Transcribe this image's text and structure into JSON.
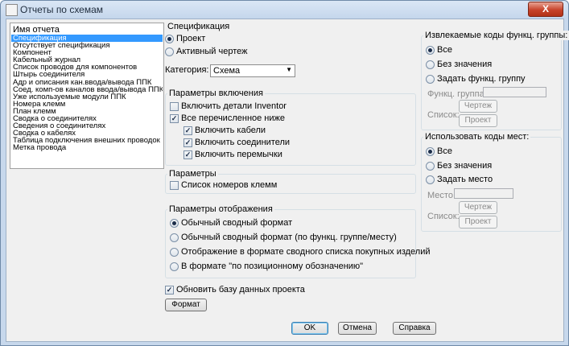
{
  "window": {
    "title": "Отчеты по схемам",
    "close": "X"
  },
  "report_list": {
    "header": "Имя отчета",
    "items": [
      "Спецификация",
      "Отсутствует спецификация",
      "Компонент",
      "Кабельный журнал",
      "Список проводов для компонентов",
      "Штырь соединителя",
      "Адр и описания кан.ввода/вывода ППК",
      "Соед. комп-ов каналов ввода/вывода ППК",
      "Уже используемые модули ППК",
      "Номера клемм",
      "План клемм",
      "Сводка о соединителях",
      "Сведения о соединителях",
      "Сводка о кабелях",
      "Таблица подключения внешних проводок",
      "Метка провода"
    ],
    "selected_index": 0
  },
  "spec": {
    "title": "Спецификация",
    "project": "Проект",
    "active": "Активный чертеж",
    "category_label": "Категория:",
    "category_value": "Схема"
  },
  "include": {
    "title": "Параметры включения",
    "inventor": "Включить детали Inventor",
    "all_below": "Все перечисленное ниже",
    "cables": "Включить кабели",
    "connectors": "Включить соединители",
    "jumpers": "Включить перемычки"
  },
  "params": {
    "title": "Параметры",
    "terminal_numbers": "Список номеров клемм"
  },
  "display": {
    "title": "Параметры отображения",
    "opt1": "Обычный сводный формат",
    "opt2": "Обычный сводный формат (по функц. группе/месту)",
    "opt3": "Отображение в формате сводного списка покупных изделий",
    "opt4": "В формате \"по позиционному обозначению\""
  },
  "update_db": "Обновить базу данных проекта",
  "format_button": "Формат",
  "func_codes": {
    "title": "Извлекаемые коды функц. группы:",
    "all": "Все",
    "none": "Без значения",
    "set": "Задать функц. группу",
    "field_label": "Функц. группа",
    "drawing_label": "Чертеж",
    "list_label": "Список:",
    "project_label": "Проект"
  },
  "loc_codes": {
    "title": "Использовать коды мест:",
    "all": "Все",
    "none": "Без значения",
    "set": "Задать место",
    "field_label": "Место",
    "drawing_label": "Чертеж",
    "list_label": "Список:",
    "project_label": "Проект"
  },
  "footer": {
    "ok": "OK",
    "cancel": "Отмена",
    "help": "Справка"
  }
}
